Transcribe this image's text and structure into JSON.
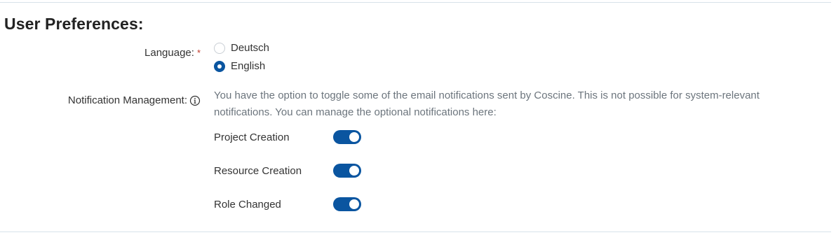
{
  "section": {
    "title": "User Preferences:"
  },
  "language": {
    "label": "Language:",
    "required_mark": "*",
    "options": [
      {
        "label": "Deutsch",
        "selected": false
      },
      {
        "label": "English",
        "selected": true
      }
    ]
  },
  "notifications": {
    "label": "Notification Management:",
    "info_icon": "info-circle-icon",
    "description": "You have the option to toggle some of the email notifications sent by Coscine. This is not possible for system-relevant notifications. You can manage the optional notifications here:",
    "toggles": [
      {
        "label": "Project Creation",
        "enabled": true
      },
      {
        "label": "Resource Creation",
        "enabled": true
      },
      {
        "label": "Role Changed",
        "enabled": true
      }
    ]
  },
  "colors": {
    "accent": "#0a55a0",
    "required": "#c0392b",
    "muted_text": "#6c757d",
    "divider": "#d8e2ea"
  }
}
